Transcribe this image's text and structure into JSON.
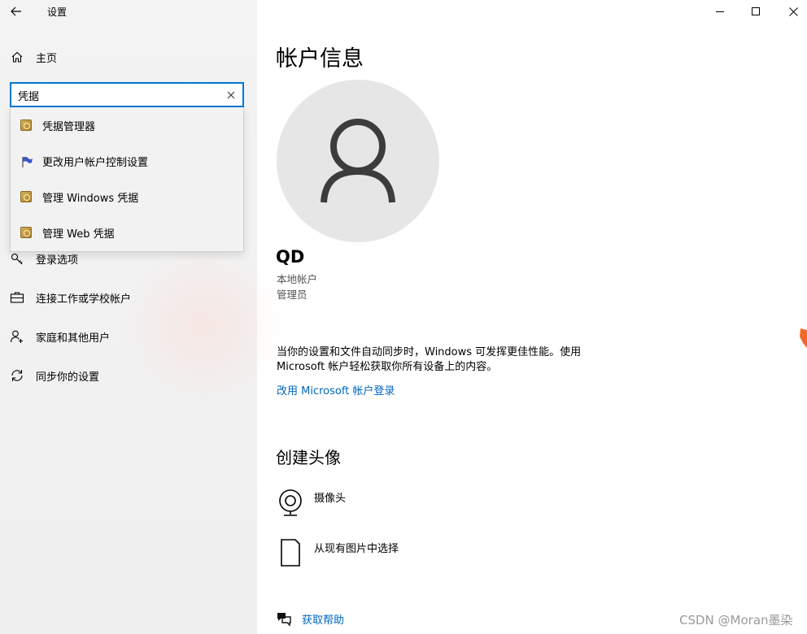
{
  "window": {
    "title": "设置",
    "minimize_glyph": "—",
    "maximize_glyph": "☐",
    "close_glyph": "✕"
  },
  "sidebar": {
    "home_label": "主页",
    "search": {
      "value": "凭据",
      "placeholder": ""
    },
    "suggestions": [
      {
        "label": "凭据管理器",
        "icon": "control-panel-icon"
      },
      {
        "label": "更改用户帐户控制设置",
        "icon": "uac-flag-icon"
      },
      {
        "label": "管理 Windows 凭据",
        "icon": "control-panel-icon"
      },
      {
        "label": "管理 Web 凭据",
        "icon": "control-panel-icon"
      }
    ],
    "items": [
      {
        "label": "登录选项",
        "icon": "key-icon"
      },
      {
        "label": "连接工作或学校帐户",
        "icon": "briefcase-icon"
      },
      {
        "label": "家庭和其他用户",
        "icon": "person-add-icon"
      },
      {
        "label": "同步你的设置",
        "icon": "sync-icon"
      }
    ]
  },
  "main": {
    "title": "帐户信息",
    "user": {
      "name": "QD",
      "account_type": "本地帐户",
      "role": "管理员"
    },
    "info_text": "当你的设置和文件自动同步时，Windows 可发挥更佳性能。使用 Microsoft 帐户轻松获取你所有设备上的内容。",
    "ms_link": "改用 Microsoft 帐户登录",
    "create_avatar": {
      "title": "创建头像",
      "options": [
        {
          "label": "摄像头",
          "icon": "webcam-icon"
        },
        {
          "label": "从现有图片中选择",
          "icon": "document-icon"
        }
      ]
    },
    "help_label": "获取帮助"
  },
  "watermark": "CSDN @Moran墨染",
  "colors": {
    "accent": "#0078d4",
    "link": "#0067c0",
    "avatar_bg": "#e6e6e6",
    "sidebar_bg": "#f2f2f2"
  }
}
